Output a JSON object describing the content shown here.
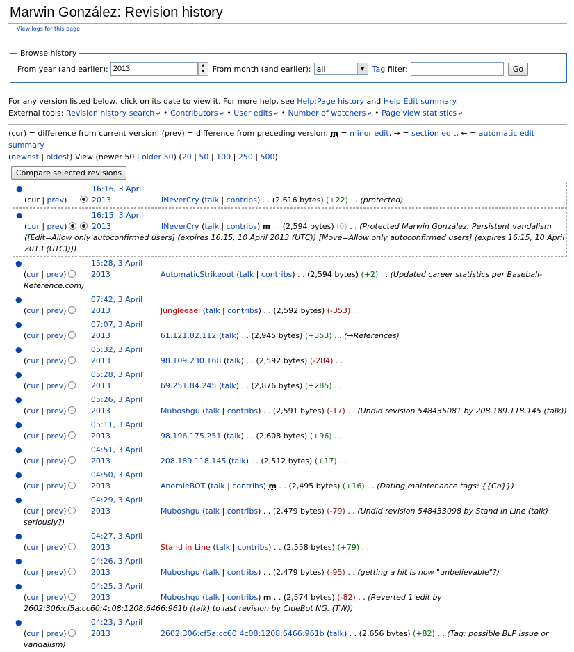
{
  "page": {
    "title": "Marwin González: Revision history",
    "view_logs": "View logs for this page"
  },
  "browse": {
    "legend": "Browse history",
    "from_year_label": "From year (and earlier):",
    "year_value": "2013",
    "from_month_label": "From month (and earlier):",
    "month_value": "all",
    "tag_link": "Tag",
    "tag_label": "filter:",
    "tag_value": "",
    "go_label": "Go"
  },
  "help": {
    "line1_a": "For any version listed below, click on its date to view it. For more help, see",
    "help_page_history": "Help:Page history",
    "and": "and",
    "help_edit_summary": "Help:Edit summary",
    "period": ".",
    "ext_label": "External tools:",
    "tools": [
      "Revision history search",
      "Contributors",
      "User edits",
      "Number of watchers",
      "Page view statistics"
    ],
    "sep": "•"
  },
  "legend_line": {
    "a": "(cur) = difference from current version, (prev) = difference from preceding version,",
    "m": "m",
    "b": "=",
    "minor": "minor edit",
    "c": ", → =",
    "section": "section edit",
    "d": ", ← =",
    "auto": "automatic edit summary"
  },
  "paging": {
    "open": "(",
    "newest": "newest",
    "bar": " | ",
    "oldest": "oldest",
    "mid": ") View (newer 50 | ",
    "older": "older 50",
    "close": ") (",
    "n20": "20",
    "n50": "50",
    "n100": "100",
    "n250": "250",
    "n500": "500",
    "end": ")"
  },
  "compare_label": "Compare selected revisions",
  "labels": {
    "cur": "cur",
    "prev": "prev",
    "talk": "talk",
    "contribs": "contribs",
    "sep": "|",
    "dots": ". ."
  },
  "revisions": [
    {
      "date": "16:16, 3 April 2013",
      "user": "INeverCry",
      "user_red": false,
      "contribs": true,
      "minor": false,
      "bytes": "(2,616 bytes)",
      "diff": "(+22)",
      "diff_kind": "pos",
      "summary": "(protected)",
      "cur_link": false,
      "prev_link": true,
      "radio_left": false,
      "radio_right": true,
      "boxed": true
    },
    {
      "date": "16:15, 3 April 2013",
      "user": "INeverCry",
      "user_red": false,
      "contribs": true,
      "minor": true,
      "bytes": "(2,594 bytes)",
      "diff": "(0)",
      "diff_kind": "zero",
      "summary": "(Protected Marwin González: Persistent vandalism ([Edit=Allow only autoconfirmed users] (expires 16:15, 10 April 2013 (UTC)) [Move=Allow only autoconfirmed users] (expires 16:15, 10 April 2013 (UTC))))",
      "cur_link": true,
      "prev_link": true,
      "radio_left": true,
      "radio_right": true,
      "radio_left_on": true,
      "boxed": true
    },
    {
      "date": "15:28, 3 April 2013",
      "user": "AutomaticStrikeout",
      "user_red": false,
      "contribs": true,
      "minor": false,
      "bytes": "(2,594 bytes)",
      "diff": "(+2)",
      "diff_kind": "pos",
      "summary": "(Updated career statistics per Baseball-Reference.com)",
      "cur_link": true,
      "prev_link": true,
      "radio_left": true,
      "radio_right": false
    },
    {
      "date": "07:42, 3 April 2013",
      "user": "Jungleeaei",
      "user_red": true,
      "contribs": true,
      "minor": false,
      "bytes": "(2,592 bytes)",
      "diff": "(-353)",
      "diff_kind": "neg",
      "summary": "",
      "cur_link": true,
      "prev_link": true,
      "radio_left": true,
      "radio_right": false
    },
    {
      "date": "07:07, 3 April 2013",
      "user": "61.121.82.112",
      "user_red": false,
      "contribs": false,
      "minor": false,
      "bytes": "(2,945 bytes)",
      "diff": "(+353)",
      "diff_kind": "pos",
      "summary": "(→References)",
      "cur_link": true,
      "prev_link": true,
      "radio_left": true,
      "radio_right": false
    },
    {
      "date": "05:32, 3 April 2013",
      "user": "98.109.230.168",
      "user_red": false,
      "contribs": false,
      "minor": false,
      "bytes": "(2,592 bytes)",
      "diff": "(-284)",
      "diff_kind": "neg",
      "summary": "",
      "cur_link": true,
      "prev_link": true,
      "radio_left": true,
      "radio_right": false
    },
    {
      "date": "05:28, 3 April 2013",
      "user": "69.251.84.245",
      "user_red": false,
      "contribs": false,
      "minor": false,
      "bytes": "(2,876 bytes)",
      "diff": "(+285)",
      "diff_kind": "pos",
      "summary": "",
      "cur_link": true,
      "prev_link": true,
      "radio_left": true,
      "radio_right": false
    },
    {
      "date": "05:26, 3 April 2013",
      "user": "Muboshgu",
      "user_red": false,
      "contribs": true,
      "minor": false,
      "bytes": "(2,591 bytes)",
      "diff": "(-17)",
      "diff_kind": "neg",
      "summary": "(Undid revision 548435081 by 208.189.118.145 (talk))",
      "cur_link": true,
      "prev_link": true,
      "radio_left": true,
      "radio_right": false
    },
    {
      "date": "05:11, 3 April 2013",
      "user": "98.196.175.251",
      "user_red": false,
      "contribs": false,
      "minor": false,
      "bytes": "(2,608 bytes)",
      "diff": "(+96)",
      "diff_kind": "pos",
      "summary": "",
      "cur_link": true,
      "prev_link": true,
      "radio_left": true,
      "radio_right": false
    },
    {
      "date": "04:51, 3 April 2013",
      "user": "208.189.118.145",
      "user_red": false,
      "contribs": false,
      "minor": false,
      "bytes": "(2,512 bytes)",
      "diff": "(+17)",
      "diff_kind": "pos",
      "summary": "",
      "cur_link": true,
      "prev_link": true,
      "radio_left": true,
      "radio_right": false
    },
    {
      "date": "04:50, 3 April 2013",
      "user": "AnomieBOT",
      "user_red": false,
      "contribs": true,
      "minor": true,
      "bytes": "(2,495 bytes)",
      "diff": "(+16)",
      "diff_kind": "pos",
      "summary": "(Dating maintenance tags: {{Cn}})",
      "cur_link": true,
      "prev_link": true,
      "radio_left": true,
      "radio_right": false
    },
    {
      "date": "04:29, 3 April 2013",
      "user": "Muboshgu",
      "user_red": false,
      "contribs": true,
      "minor": false,
      "bytes": "(2,479 bytes)",
      "diff": "(-79)",
      "diff_kind": "neg",
      "summary": "(Undid revision 548433098 by Stand in Line (talk) seriously?)",
      "cur_link": true,
      "prev_link": true,
      "radio_left": true,
      "radio_right": false
    },
    {
      "date": "04:27, 3 April 2013",
      "user": "Stand in Line",
      "user_red": true,
      "contribs": true,
      "minor": false,
      "bytes": "(2,558 bytes)",
      "diff": "(+79)",
      "diff_kind": "pos",
      "summary": "",
      "cur_link": true,
      "prev_link": true,
      "radio_left": true,
      "radio_right": false
    },
    {
      "date": "04:26, 3 April 2013",
      "user": "Muboshgu",
      "user_red": false,
      "contribs": true,
      "minor": false,
      "bytes": "(2,479 bytes)",
      "diff": "(-95)",
      "diff_kind": "neg",
      "summary": "(getting a hit is now \"unbelievable\"?)",
      "cur_link": true,
      "prev_link": true,
      "radio_left": true,
      "radio_right": false
    },
    {
      "date": "04:25, 3 April 2013",
      "user": "Muboshgu",
      "user_red": false,
      "contribs": true,
      "minor": true,
      "bytes": "(2,574 bytes)",
      "diff": "(-82)",
      "diff_kind": "neg",
      "summary": "(Reverted 1 edit by 2602:306:cf5a:cc60:4c08:1208:6466:961b (talk) to last revision by ClueBot NG. (TW))",
      "cur_link": true,
      "prev_link": true,
      "radio_left": true,
      "radio_right": false
    },
    {
      "date": "04:23, 3 April 2013",
      "user": "2602:306:cf5a:cc60:4c08:1208:6466:961b",
      "user_red": false,
      "contribs": false,
      "minor": false,
      "bytes": "(2,656 bytes)",
      "diff": "(+82)",
      "diff_kind": "pos",
      "summary": "(Tag: possible BLP issue or vandalism)",
      "cur_link": true,
      "prev_link": true,
      "radio_left": true,
      "radio_right": false
    }
  ]
}
